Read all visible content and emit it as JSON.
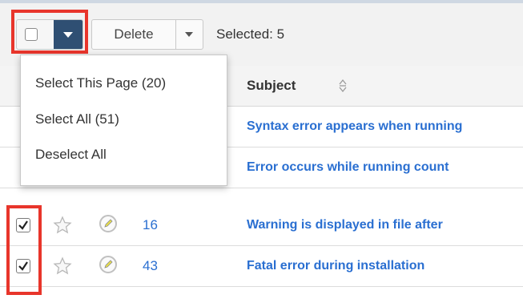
{
  "toolbar": {
    "delete_label": "Delete",
    "selected_label": "Selected: 5"
  },
  "dropdown": {
    "items": [
      "Select This Page (20)",
      "Select All (51)",
      "Deselect All"
    ]
  },
  "table": {
    "columns": {
      "subject": "Subject"
    },
    "rows": [
      {
        "number": "",
        "subject": "Syntax error appears when running",
        "checked": true
      },
      {
        "number": "",
        "subject": "Error occurs while running count",
        "checked": true
      },
      {
        "number": "16",
        "subject": "Warning is displayed in file after",
        "checked": true
      },
      {
        "number": "43",
        "subject": "Fatal error during installation",
        "checked": true
      }
    ]
  },
  "colors": {
    "accent": "#2f4f73",
    "link": "#2a6fd1",
    "highlight": "#e8352b"
  },
  "icons": [
    "checkbox-icon",
    "caret-down-icon",
    "sort-icon",
    "star-icon",
    "pencil-icon",
    "checkmark-icon"
  ]
}
